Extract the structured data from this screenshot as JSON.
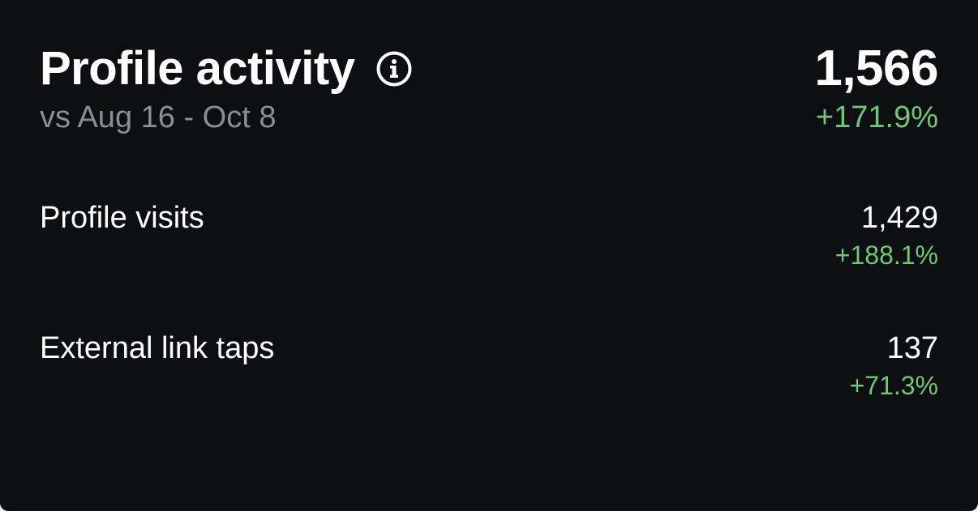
{
  "header": {
    "title": "Profile activity",
    "info_icon": "info-circle-icon",
    "comparison": "vs Aug 16 - Oct 8",
    "total_value": "1,566",
    "total_change": "+171.9%"
  },
  "metrics": [
    {
      "label": "Profile visits",
      "value": "1,429",
      "change": "+188.1%"
    },
    {
      "label": "External link taps",
      "value": "137",
      "change": "+71.3%"
    }
  ],
  "colors": {
    "background": "#0d0f13",
    "positive_change": "#73c577",
    "secondary_text": "#8a8e97",
    "primary_text": "#ffffff"
  }
}
